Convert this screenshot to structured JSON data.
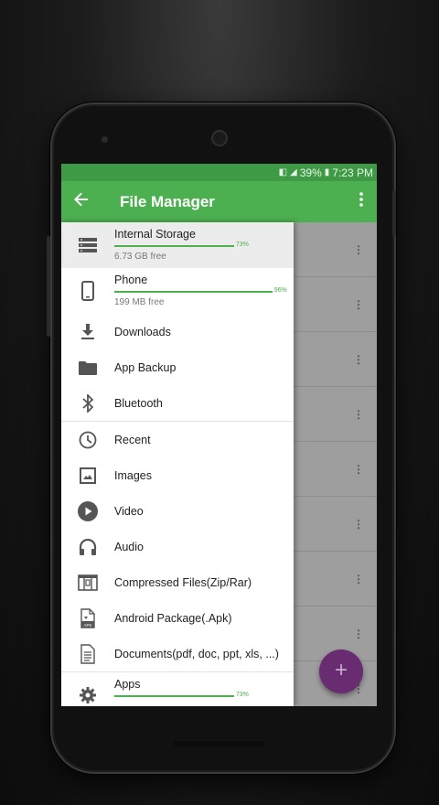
{
  "status": {
    "signal_glyph": "▼",
    "battery_pct": "39%",
    "time": "7:23 PM"
  },
  "appbar": {
    "title": "File Manager",
    "back_icon": "arrow-left-icon",
    "menu_icon": "more-vert-icon"
  },
  "drawer": {
    "storages": [
      {
        "name": "Internal Storage",
        "pct_label": "73%",
        "fill": 0.73,
        "free": "6.73 GB free",
        "icon": "storage-icon"
      },
      {
        "name": "Phone",
        "pct_label": "96%",
        "fill": 0.96,
        "free": "199 MB free",
        "icon": "phone-icon"
      }
    ],
    "group1": [
      {
        "label": "Downloads",
        "icon": "download-icon"
      },
      {
        "label": "App Backup",
        "icon": "folder-icon"
      },
      {
        "label": "Bluetooth",
        "icon": "bluetooth-icon"
      }
    ],
    "group2": [
      {
        "label": "Recent",
        "icon": "clock-icon"
      },
      {
        "label": "Images",
        "icon": "image-icon"
      },
      {
        "label": "Video",
        "icon": "play-icon"
      },
      {
        "label": "Audio",
        "icon": "headphones-icon"
      },
      {
        "label": "Compressed Files(Zip/Rar)",
        "icon": "archive-icon"
      },
      {
        "label": "Android Package(.Apk)",
        "icon": "apk-icon"
      },
      {
        "label": "Documents(pdf, doc, ppt, xls, ...)",
        "icon": "document-icon"
      }
    ],
    "apps": {
      "name": "Apps",
      "pct_label": "73%",
      "fill": 0.73,
      "icon": "gear-icon"
    }
  },
  "fab": {
    "label": "+"
  },
  "colors": {
    "primary": "#4caf50",
    "statusbar": "#3e9a45",
    "fab": "#6a2c70"
  }
}
